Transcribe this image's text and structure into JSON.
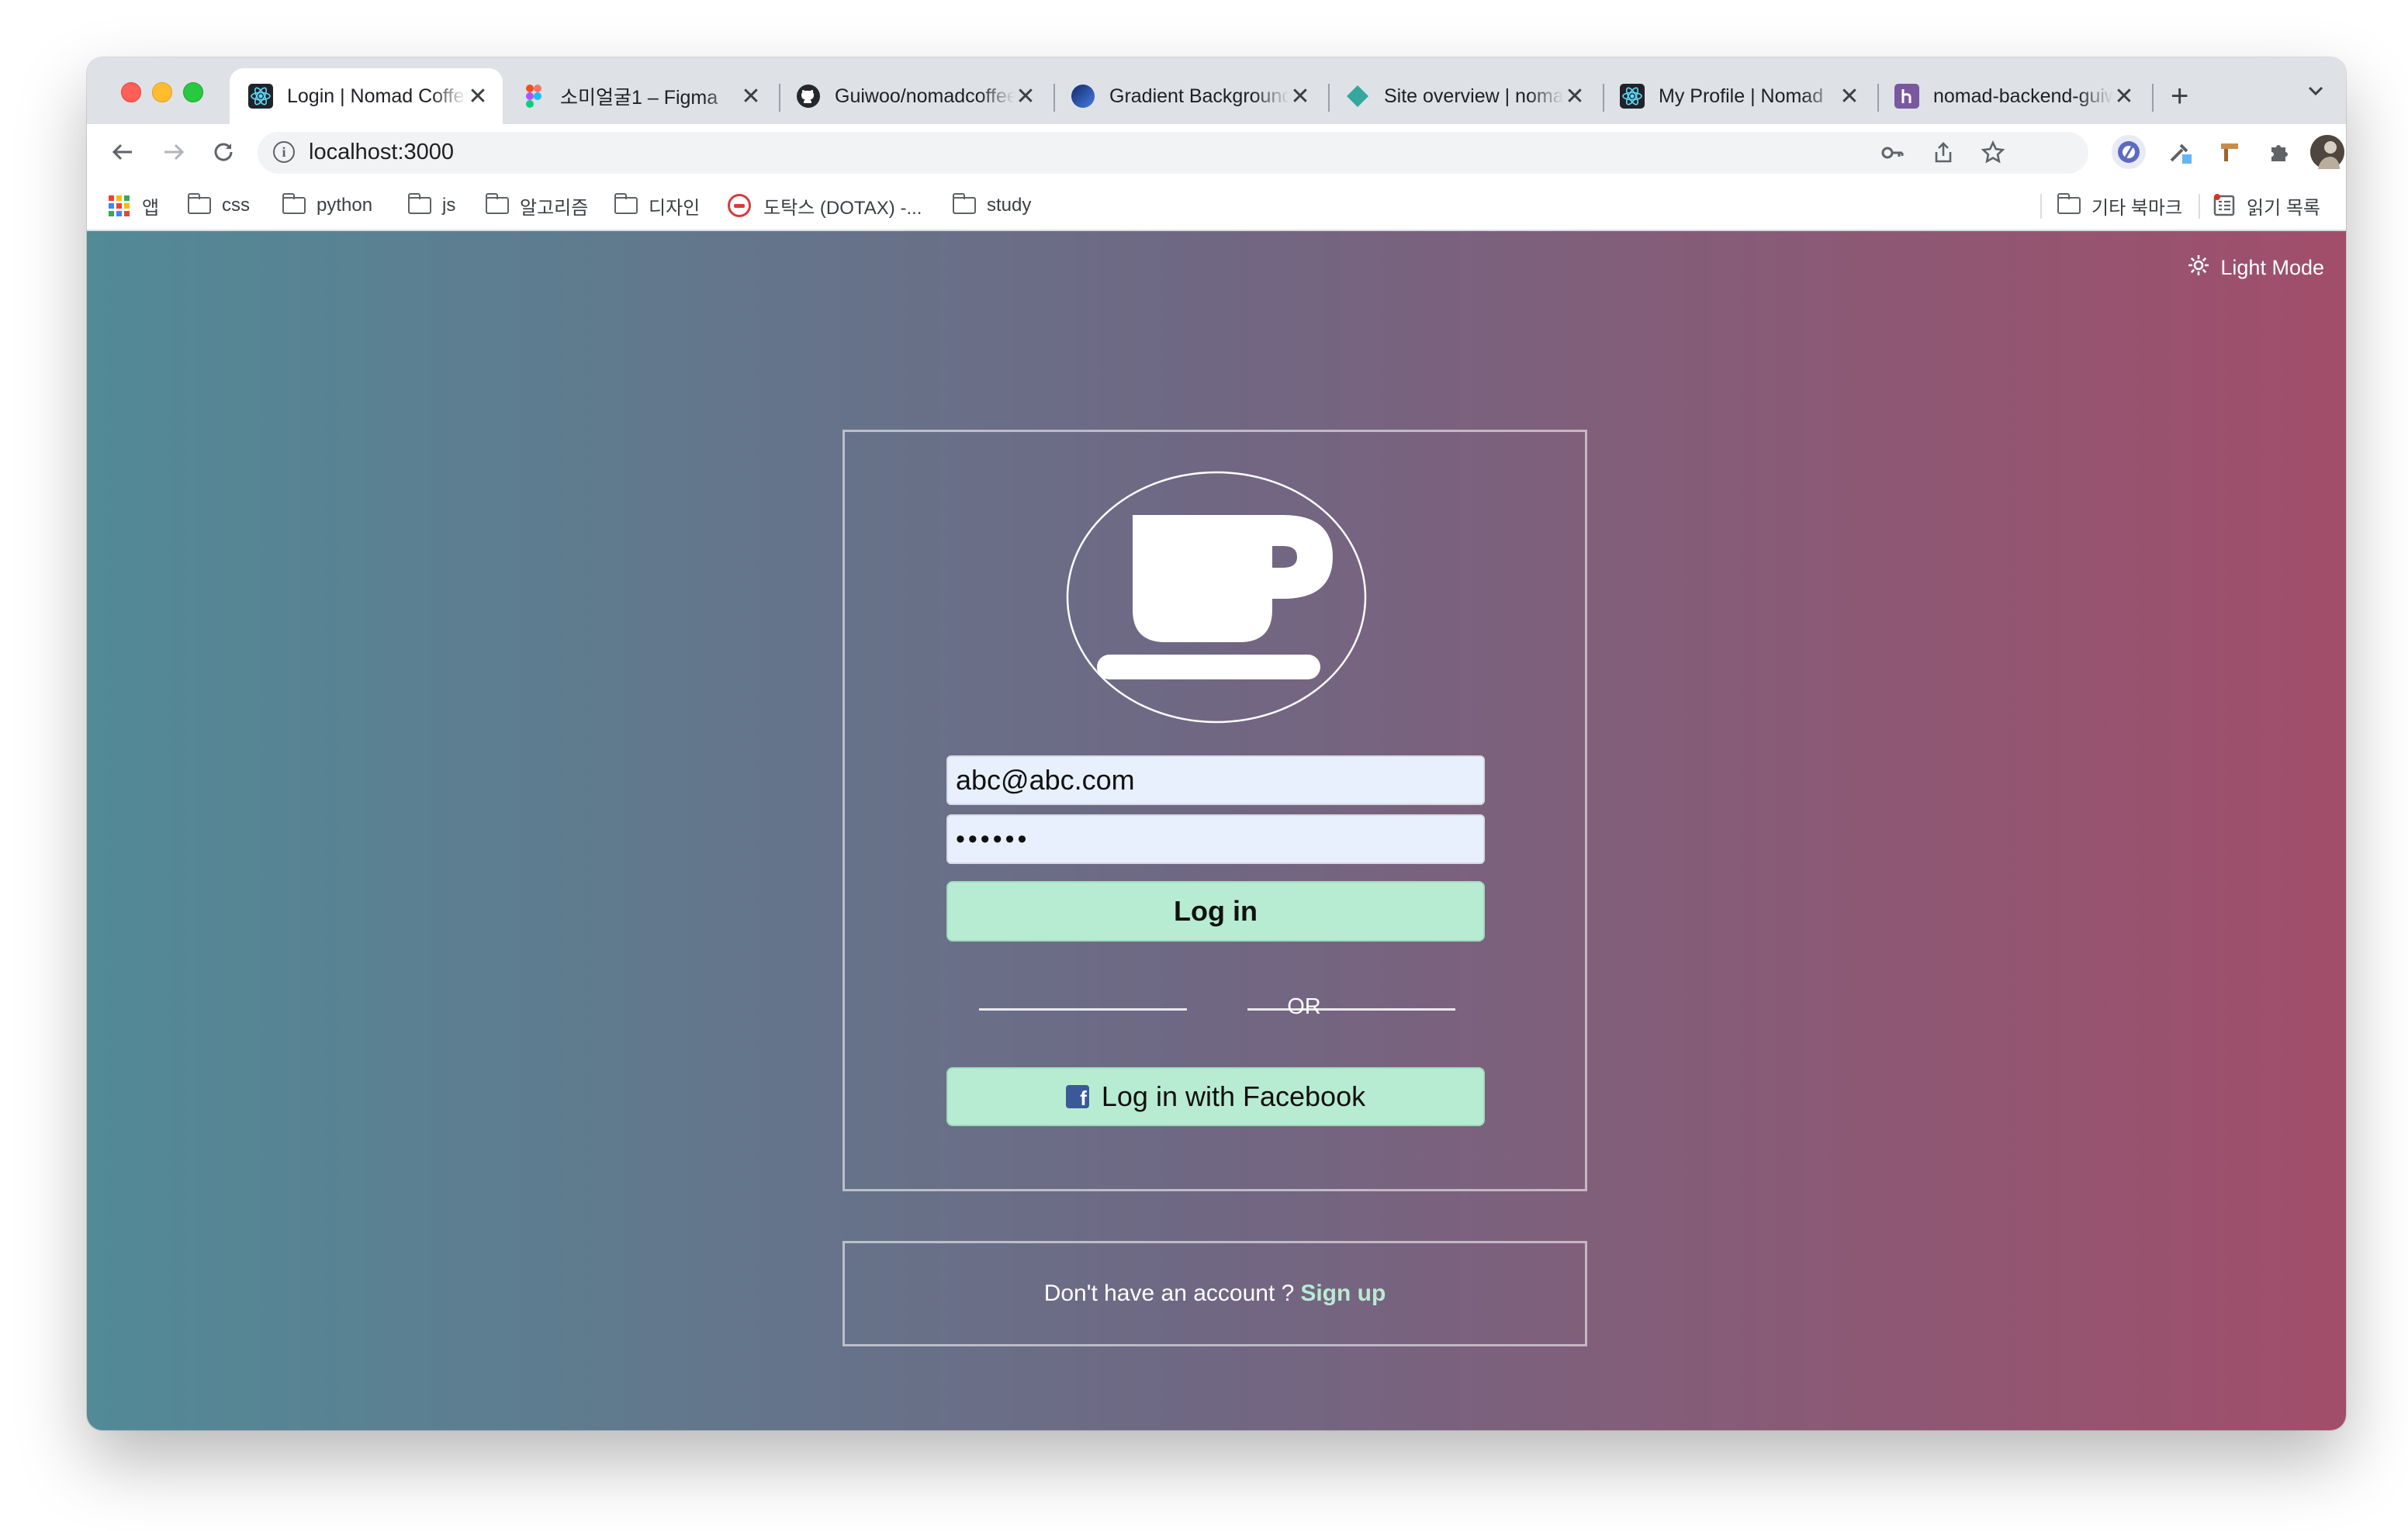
{
  "browser": {
    "tabs": [
      {
        "title": "Login | Nomad Coffee",
        "favicon": "react-icon",
        "active": true
      },
      {
        "title": "소미얼굴1 – Figma",
        "favicon": "figma-icon",
        "active": false
      },
      {
        "title": "Guiwoo/nomadcoffee",
        "favicon": "github-icon",
        "active": false
      },
      {
        "title": "Gradient Background",
        "favicon": "gradient-icon",
        "active": false
      },
      {
        "title": "Site overview | nomad",
        "favicon": "netlify-icon",
        "active": false
      },
      {
        "title": "My Profile | Nomad",
        "favicon": "react-icon",
        "active": false
      },
      {
        "title": "nomad-backend-guiwoo",
        "favicon": "heroku-icon",
        "active": false
      }
    ],
    "close_symbol": "✕",
    "new_tab_symbol": "+",
    "url": "localhost:3000"
  },
  "bookmarks": {
    "apps_label": "앱",
    "items": [
      {
        "label": "css",
        "icon": "folder-icon"
      },
      {
        "label": "python",
        "icon": "folder-icon"
      },
      {
        "label": "js",
        "icon": "folder-icon"
      },
      {
        "label": "알고리즘",
        "icon": "folder-icon"
      },
      {
        "label": "디자인",
        "icon": "folder-icon"
      },
      {
        "label": "도탁스 (DOTAX) -...",
        "icon": "dotax-icon"
      },
      {
        "label": "study",
        "icon": "folder-icon"
      }
    ],
    "other_label": "기타 북마크",
    "reading_list_label": "읽기 목록"
  },
  "page": {
    "theme_toggle_label": "Light Mode",
    "email_value": "abc@abc.com",
    "password_value": "••••••",
    "login_button": "Log in",
    "or_text": "OR",
    "facebook_button": "Log in with Facebook",
    "signup_prompt": "Don't have an account ?",
    "signup_link": "Sign up"
  },
  "colors": {
    "gradient_start": "#528a97",
    "gradient_end": "#a14e6a",
    "button_bg": "#b8ecd2",
    "input_bg": "#e8f0fe",
    "facebook_blue": "#3b5998"
  }
}
